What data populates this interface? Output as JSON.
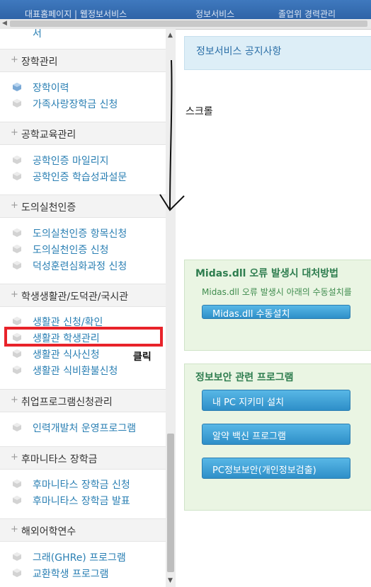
{
  "topnav": {
    "items": [
      "대표홈페이지 | 웹정보서비스",
      "정보서비스",
      "졸업위 경력관리"
    ]
  },
  "sidebar": {
    "top_cut_text": "서",
    "sections": [
      {
        "title": "장학관리",
        "items": [
          "장학이력",
          "가족사랑장학금 신청"
        ]
      },
      {
        "title": "공학교육관리",
        "items": [
          "공학인증 마일리지",
          "공학인증 학습성과설문"
        ]
      },
      {
        "title": "도의실천인증",
        "items": [
          "도의실천인증 항목신청",
          "도의실천인증 신청",
          "덕성훈련심화과정 신청"
        ]
      },
      {
        "title": "학생생활관/도덕관/국시관",
        "items": [
          "생활관 신청/확인",
          "생활관 학생관리",
          "생활관 식사신청",
          "생활관 식비환불신청"
        ]
      },
      {
        "title": "취업프로그램신청관리",
        "items": [
          "인력개발처 운영프로그램"
        ]
      },
      {
        "title": "후마니타스 장학금",
        "items": [
          "후마니타스 장학금 신청",
          "후마니타스 장학금 발표"
        ]
      },
      {
        "title": "해외어학연수",
        "items": [
          "그래(GHRe) 프로그램",
          "교환학생 프로그램"
        ]
      }
    ]
  },
  "panels": {
    "notice": "정보서비스 공지사항",
    "midas": {
      "title": "Midas.dll 오류 발생시 대처방법",
      "desc": "Midas.dll 오류 발생시 아래의 수동설치를",
      "button": "Midas.dll 수동설치"
    },
    "security": {
      "title": "정보보안 관련 프로그램",
      "buttons": [
        "내 PC 지키미 설치",
        "알약 백신 프로그램",
        "PC정보보안(개인정보검출)"
      ]
    }
  },
  "annotations": {
    "scroll_note": "스크롤",
    "click_note": "클릭"
  },
  "colors": {
    "highlight": "#e8232a",
    "link": "#2a7fb3"
  }
}
